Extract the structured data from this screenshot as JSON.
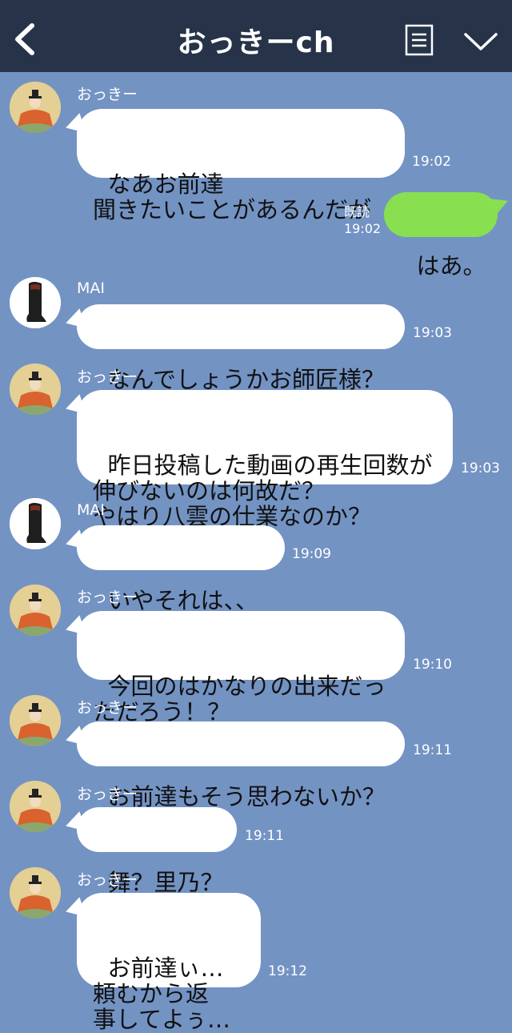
{
  "header": {
    "title": "おっきーch",
    "back_icon": "chevron-left-icon",
    "menu_icon": "menu-list-icon",
    "collapse_icon": "chevron-down-icon",
    "bg_color": "#263348"
  },
  "chat": {
    "bg_color": "#7393c3",
    "messages": [
      {
        "sender": "おっきー",
        "text": "なあお前達\n聞きたいことがあるんだが",
        "time": "19:02"
      },
      {
        "sender": "me",
        "text": "はあ。",
        "read": "既読",
        "time": "19:02"
      },
      {
        "sender": "MAI",
        "text": "なんでしょうかお師匠様？",
        "time": "19:03"
      },
      {
        "sender": "おっきー",
        "text": "昨日投稿した動画の再生回数が\n伸びないのは何故だ？\nやはり八雲の仕業なのか？",
        "time": "19:03"
      },
      {
        "sender": "MAI",
        "text": "いやそれは、、",
        "time": "19:09"
      },
      {
        "sender": "おっきー",
        "text": "今回のはかなりの出来だっ\nただろう！？",
        "time": "19:10"
      },
      {
        "sender": "おっきー",
        "text": "お前達もそう思わないか？",
        "time": "19:11"
      },
      {
        "sender": "おっきー",
        "text": "舞？里乃？",
        "time": "19:11"
      },
      {
        "sender": "おっきー",
        "text": "お前達ぃ…\n頼むから返\n事してよぅ…",
        "time": "19:12"
      }
    ]
  }
}
